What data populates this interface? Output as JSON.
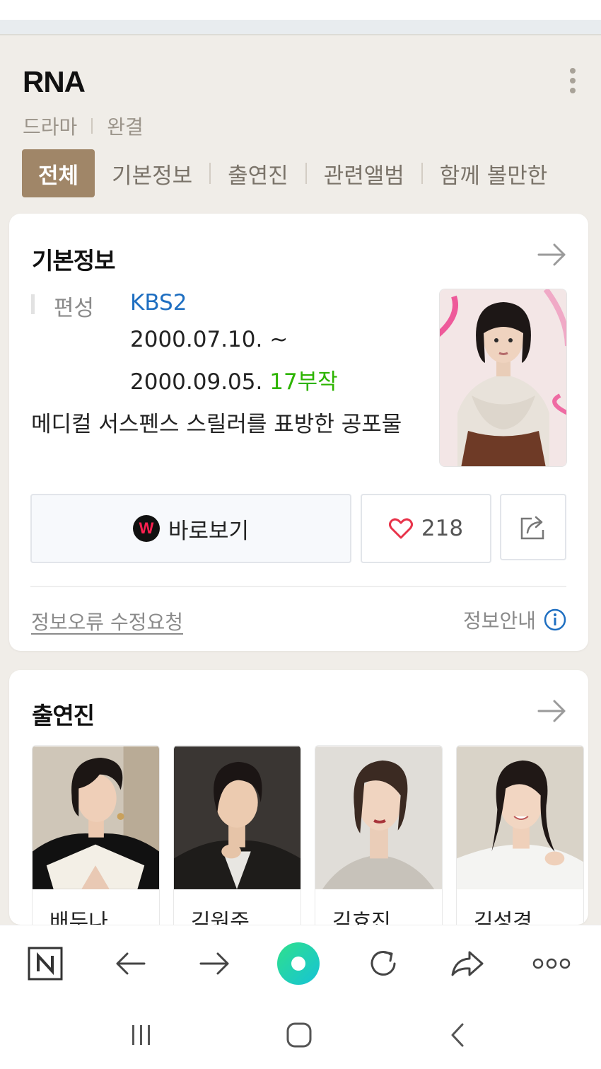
{
  "header": {
    "title": "RNA",
    "meta": [
      "드라마",
      "완결"
    ]
  },
  "tabs": [
    {
      "label": "전체",
      "active": true
    },
    {
      "label": "기본정보",
      "active": false
    },
    {
      "label": "출연진",
      "active": false
    },
    {
      "label": "관련앨범",
      "active": false
    },
    {
      "label": "함께 볼만한",
      "active": false
    }
  ],
  "basic_info": {
    "title": "기본정보",
    "label": "편성",
    "channel": "KBS2",
    "date_start": "2000.07.10. ~",
    "date_end": "2000.09.05.",
    "episodes": "17부작",
    "description": "메디컬 서스펜스 스릴러를 표방한 공포물",
    "watch_label": "바로보기",
    "watch_logo": "W",
    "like_count": "218",
    "report_link": "정보오류 수정요청",
    "guide_link": "정보안내"
  },
  "cast": {
    "title": "출연진",
    "members": [
      {
        "name": "배두나"
      },
      {
        "name": "김원준"
      },
      {
        "name": "김효진"
      },
      {
        "name": "김성경"
      }
    ]
  },
  "colors": {
    "tab_active": "#a08668",
    "link_blue": "#1f6fc1",
    "accent_green": "#2db400",
    "heart_red": "#e8334a"
  },
  "icons": {
    "bottom_nav": [
      "naver-n-icon",
      "back-arrow-icon",
      "forward-arrow-icon",
      "green-dot-icon",
      "refresh-icon",
      "share-icon",
      "more-icon"
    ],
    "system_nav": [
      "recent-apps-icon",
      "home-icon",
      "system-back-icon"
    ]
  }
}
